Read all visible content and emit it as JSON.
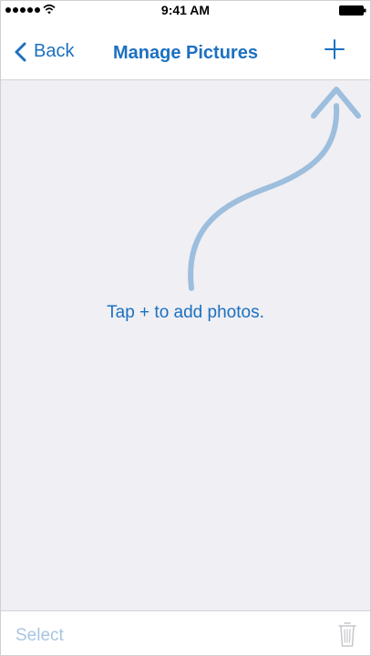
{
  "status_bar": {
    "time": "9:41 AM",
    "signal_icon": "signal-dots-icon",
    "wifi_icon": "wifi-icon",
    "battery_icon": "battery-icon"
  },
  "nav": {
    "back_label": "Back",
    "title": "Manage Pictures",
    "add_icon": "plus-icon",
    "accent_color": "#1c70c0"
  },
  "content": {
    "hint": "Tap + to add photos.",
    "background_color": "#efeff4",
    "arrow_icon": "curved-arrow-icon"
  },
  "toolbar": {
    "select_label": "Select",
    "trash_icon": "trash-icon",
    "disabled_color": "#a9c5e2"
  }
}
